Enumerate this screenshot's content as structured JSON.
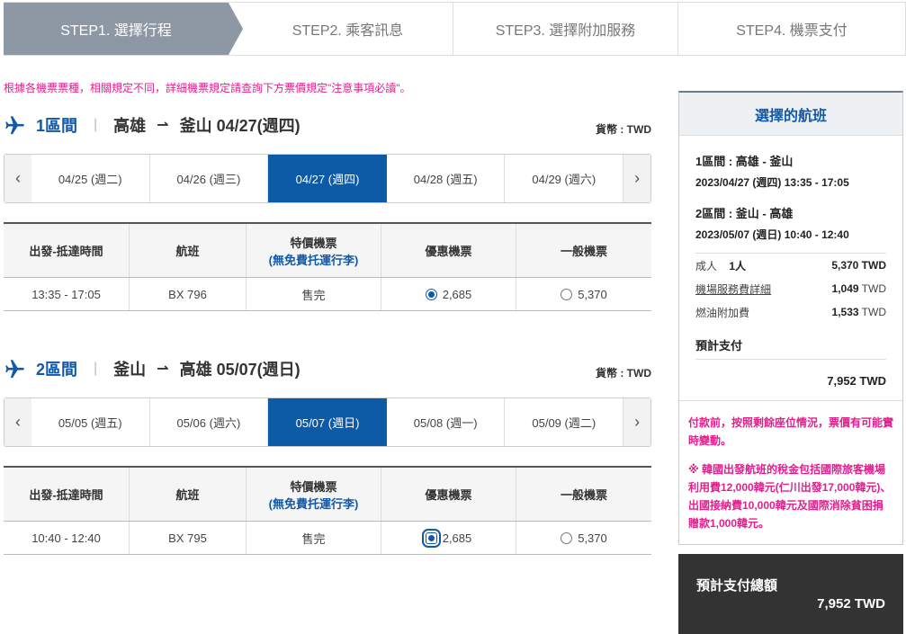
{
  "steps": [
    {
      "label": "STEP1. 選擇行程"
    },
    {
      "label": "STEP2. 乘客訊息"
    },
    {
      "label": "STEP3. 選擇附加服務"
    },
    {
      "label": "STEP4. 機票支付"
    }
  ],
  "notice": "根據各機票票種，相關規定不同，詳細機票規定請查詢下方票價規定\"注意事項必讀\"。",
  "segments": [
    {
      "no": "1區間",
      "from": "高雄",
      "to": "釜山",
      "date": "04/27(週四)",
      "currency": "貨幣 : TWD",
      "dates": [
        "04/25 (週二)",
        "04/26 (週三)",
        "04/27 (週四)",
        "04/28 (週五)",
        "04/29 (週六)"
      ],
      "active_index": 2,
      "headers": {
        "time": "出發-抵達時間",
        "flight": "航班",
        "special": "特價機票",
        "special_sub": "(無免費托運行李)",
        "discount": "優惠機票",
        "regular": "一般機票"
      },
      "row": {
        "time": "13:35 - 17:05",
        "flight": "BX 796",
        "special": "售完",
        "discount": "2,685",
        "regular": "5,370"
      }
    },
    {
      "no": "2區間",
      "from": "釜山",
      "to": "高雄",
      "date": "05/07(週日)",
      "currency": "貨幣 : TWD",
      "dates": [
        "05/05 (週五)",
        "05/06 (週六)",
        "05/07 (週日)",
        "05/08 (週一)",
        "05/09 (週二)"
      ],
      "active_index": 2,
      "headers": {
        "time": "出發-抵達時間",
        "flight": "航班",
        "special": "特價機票",
        "special_sub": "(無免費托運行李)",
        "discount": "優惠機票",
        "regular": "一般機票"
      },
      "row": {
        "time": "10:40 - 12:40",
        "flight": "BX 795",
        "special": "售完",
        "discount": "2,685",
        "regular": "5,370"
      }
    }
  ],
  "nav": {
    "prev": "‹",
    "next": "›"
  },
  "panel": {
    "title": "選擇的航班",
    "leg1_title": "1區間 : 高雄 - 釜山",
    "leg1_time": "2023/04/27 (週四) 13:35 - 17:05",
    "leg2_title": "2區間 : 釜山 - 高雄",
    "leg2_time": "2023/05/07 (週日) 10:40 - 12:40",
    "adult_label": "成人",
    "adult_count": "1人",
    "adult_value": "5,370 TWD",
    "airport_fee_label": "機場服務費詳細",
    "airport_fee_value": "1,049",
    "fuel_label": "燃油附加費",
    "fuel_value": "1,533",
    "unit": "TWD",
    "estimate_label": "預計支付",
    "estimate_value": "7,952 TWD",
    "warn1": "付款前，按照剩餘座位情況，票價有可能實時變動。",
    "warn2": "※ 韓國出發航班的稅金包括國際旅客機場利用費12,000韓元(仁川出發17,000韓元)、出國接納費10,000韓元及國際消除貧困捐贈款1,000韓元。"
  },
  "total": {
    "label": "預計支付總額",
    "value": "7,952 TWD"
  }
}
